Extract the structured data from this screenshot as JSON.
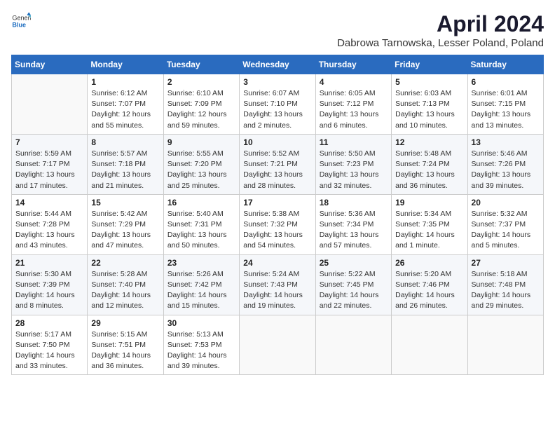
{
  "logo": {
    "general": "General",
    "blue": "Blue"
  },
  "title": "April 2024",
  "subtitle": "Dabrowa Tarnowska, Lesser Poland, Poland",
  "weekdays": [
    "Sunday",
    "Monday",
    "Tuesday",
    "Wednesday",
    "Thursday",
    "Friday",
    "Saturday"
  ],
  "weeks": [
    [
      {
        "day": "",
        "info": ""
      },
      {
        "day": "1",
        "info": "Sunrise: 6:12 AM\nSunset: 7:07 PM\nDaylight: 12 hours\nand 55 minutes."
      },
      {
        "day": "2",
        "info": "Sunrise: 6:10 AM\nSunset: 7:09 PM\nDaylight: 12 hours\nand 59 minutes."
      },
      {
        "day": "3",
        "info": "Sunrise: 6:07 AM\nSunset: 7:10 PM\nDaylight: 13 hours\nand 2 minutes."
      },
      {
        "day": "4",
        "info": "Sunrise: 6:05 AM\nSunset: 7:12 PM\nDaylight: 13 hours\nand 6 minutes."
      },
      {
        "day": "5",
        "info": "Sunrise: 6:03 AM\nSunset: 7:13 PM\nDaylight: 13 hours\nand 10 minutes."
      },
      {
        "day": "6",
        "info": "Sunrise: 6:01 AM\nSunset: 7:15 PM\nDaylight: 13 hours\nand 13 minutes."
      }
    ],
    [
      {
        "day": "7",
        "info": "Sunrise: 5:59 AM\nSunset: 7:17 PM\nDaylight: 13 hours\nand 17 minutes."
      },
      {
        "day": "8",
        "info": "Sunrise: 5:57 AM\nSunset: 7:18 PM\nDaylight: 13 hours\nand 21 minutes."
      },
      {
        "day": "9",
        "info": "Sunrise: 5:55 AM\nSunset: 7:20 PM\nDaylight: 13 hours\nand 25 minutes."
      },
      {
        "day": "10",
        "info": "Sunrise: 5:52 AM\nSunset: 7:21 PM\nDaylight: 13 hours\nand 28 minutes."
      },
      {
        "day": "11",
        "info": "Sunrise: 5:50 AM\nSunset: 7:23 PM\nDaylight: 13 hours\nand 32 minutes."
      },
      {
        "day": "12",
        "info": "Sunrise: 5:48 AM\nSunset: 7:24 PM\nDaylight: 13 hours\nand 36 minutes."
      },
      {
        "day": "13",
        "info": "Sunrise: 5:46 AM\nSunset: 7:26 PM\nDaylight: 13 hours\nand 39 minutes."
      }
    ],
    [
      {
        "day": "14",
        "info": "Sunrise: 5:44 AM\nSunset: 7:28 PM\nDaylight: 13 hours\nand 43 minutes."
      },
      {
        "day": "15",
        "info": "Sunrise: 5:42 AM\nSunset: 7:29 PM\nDaylight: 13 hours\nand 47 minutes."
      },
      {
        "day": "16",
        "info": "Sunrise: 5:40 AM\nSunset: 7:31 PM\nDaylight: 13 hours\nand 50 minutes."
      },
      {
        "day": "17",
        "info": "Sunrise: 5:38 AM\nSunset: 7:32 PM\nDaylight: 13 hours\nand 54 minutes."
      },
      {
        "day": "18",
        "info": "Sunrise: 5:36 AM\nSunset: 7:34 PM\nDaylight: 13 hours\nand 57 minutes."
      },
      {
        "day": "19",
        "info": "Sunrise: 5:34 AM\nSunset: 7:35 PM\nDaylight: 14 hours\nand 1 minute."
      },
      {
        "day": "20",
        "info": "Sunrise: 5:32 AM\nSunset: 7:37 PM\nDaylight: 14 hours\nand 5 minutes."
      }
    ],
    [
      {
        "day": "21",
        "info": "Sunrise: 5:30 AM\nSunset: 7:39 PM\nDaylight: 14 hours\nand 8 minutes."
      },
      {
        "day": "22",
        "info": "Sunrise: 5:28 AM\nSunset: 7:40 PM\nDaylight: 14 hours\nand 12 minutes."
      },
      {
        "day": "23",
        "info": "Sunrise: 5:26 AM\nSunset: 7:42 PM\nDaylight: 14 hours\nand 15 minutes."
      },
      {
        "day": "24",
        "info": "Sunrise: 5:24 AM\nSunset: 7:43 PM\nDaylight: 14 hours\nand 19 minutes."
      },
      {
        "day": "25",
        "info": "Sunrise: 5:22 AM\nSunset: 7:45 PM\nDaylight: 14 hours\nand 22 minutes."
      },
      {
        "day": "26",
        "info": "Sunrise: 5:20 AM\nSunset: 7:46 PM\nDaylight: 14 hours\nand 26 minutes."
      },
      {
        "day": "27",
        "info": "Sunrise: 5:18 AM\nSunset: 7:48 PM\nDaylight: 14 hours\nand 29 minutes."
      }
    ],
    [
      {
        "day": "28",
        "info": "Sunrise: 5:17 AM\nSunset: 7:50 PM\nDaylight: 14 hours\nand 33 minutes."
      },
      {
        "day": "29",
        "info": "Sunrise: 5:15 AM\nSunset: 7:51 PM\nDaylight: 14 hours\nand 36 minutes."
      },
      {
        "day": "30",
        "info": "Sunrise: 5:13 AM\nSunset: 7:53 PM\nDaylight: 14 hours\nand 39 minutes."
      },
      {
        "day": "",
        "info": ""
      },
      {
        "day": "",
        "info": ""
      },
      {
        "day": "",
        "info": ""
      },
      {
        "day": "",
        "info": ""
      }
    ]
  ]
}
